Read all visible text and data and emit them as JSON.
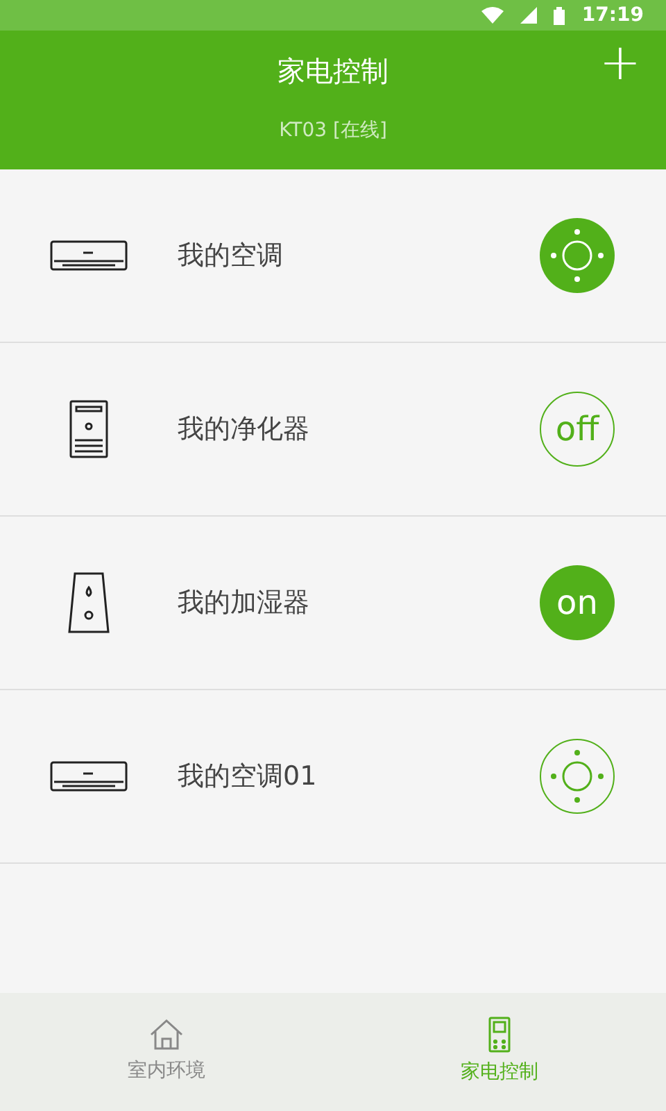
{
  "status_bar": {
    "time": "17:19"
  },
  "header": {
    "title": "家电控制",
    "subtitle": "KT03 [在线]",
    "action": "+"
  },
  "devices": [
    {
      "kind": "ac",
      "name": "我的空调",
      "control": {
        "kind": "remote",
        "on": true
      }
    },
    {
      "kind": "purifier",
      "name": "我的净化器",
      "control": {
        "kind": "power",
        "label": "off",
        "on": false
      }
    },
    {
      "kind": "humidifier",
      "name": "我的加湿器",
      "control": {
        "kind": "power",
        "label": "on",
        "on": true
      }
    },
    {
      "kind": "ac",
      "name": "我的空调01",
      "control": {
        "kind": "remote",
        "on": false
      }
    }
  ],
  "tabs": [
    {
      "label": "室内环境",
      "kind": "home",
      "selected": false
    },
    {
      "label": "家电控制",
      "kind": "remote",
      "selected": true
    }
  ]
}
